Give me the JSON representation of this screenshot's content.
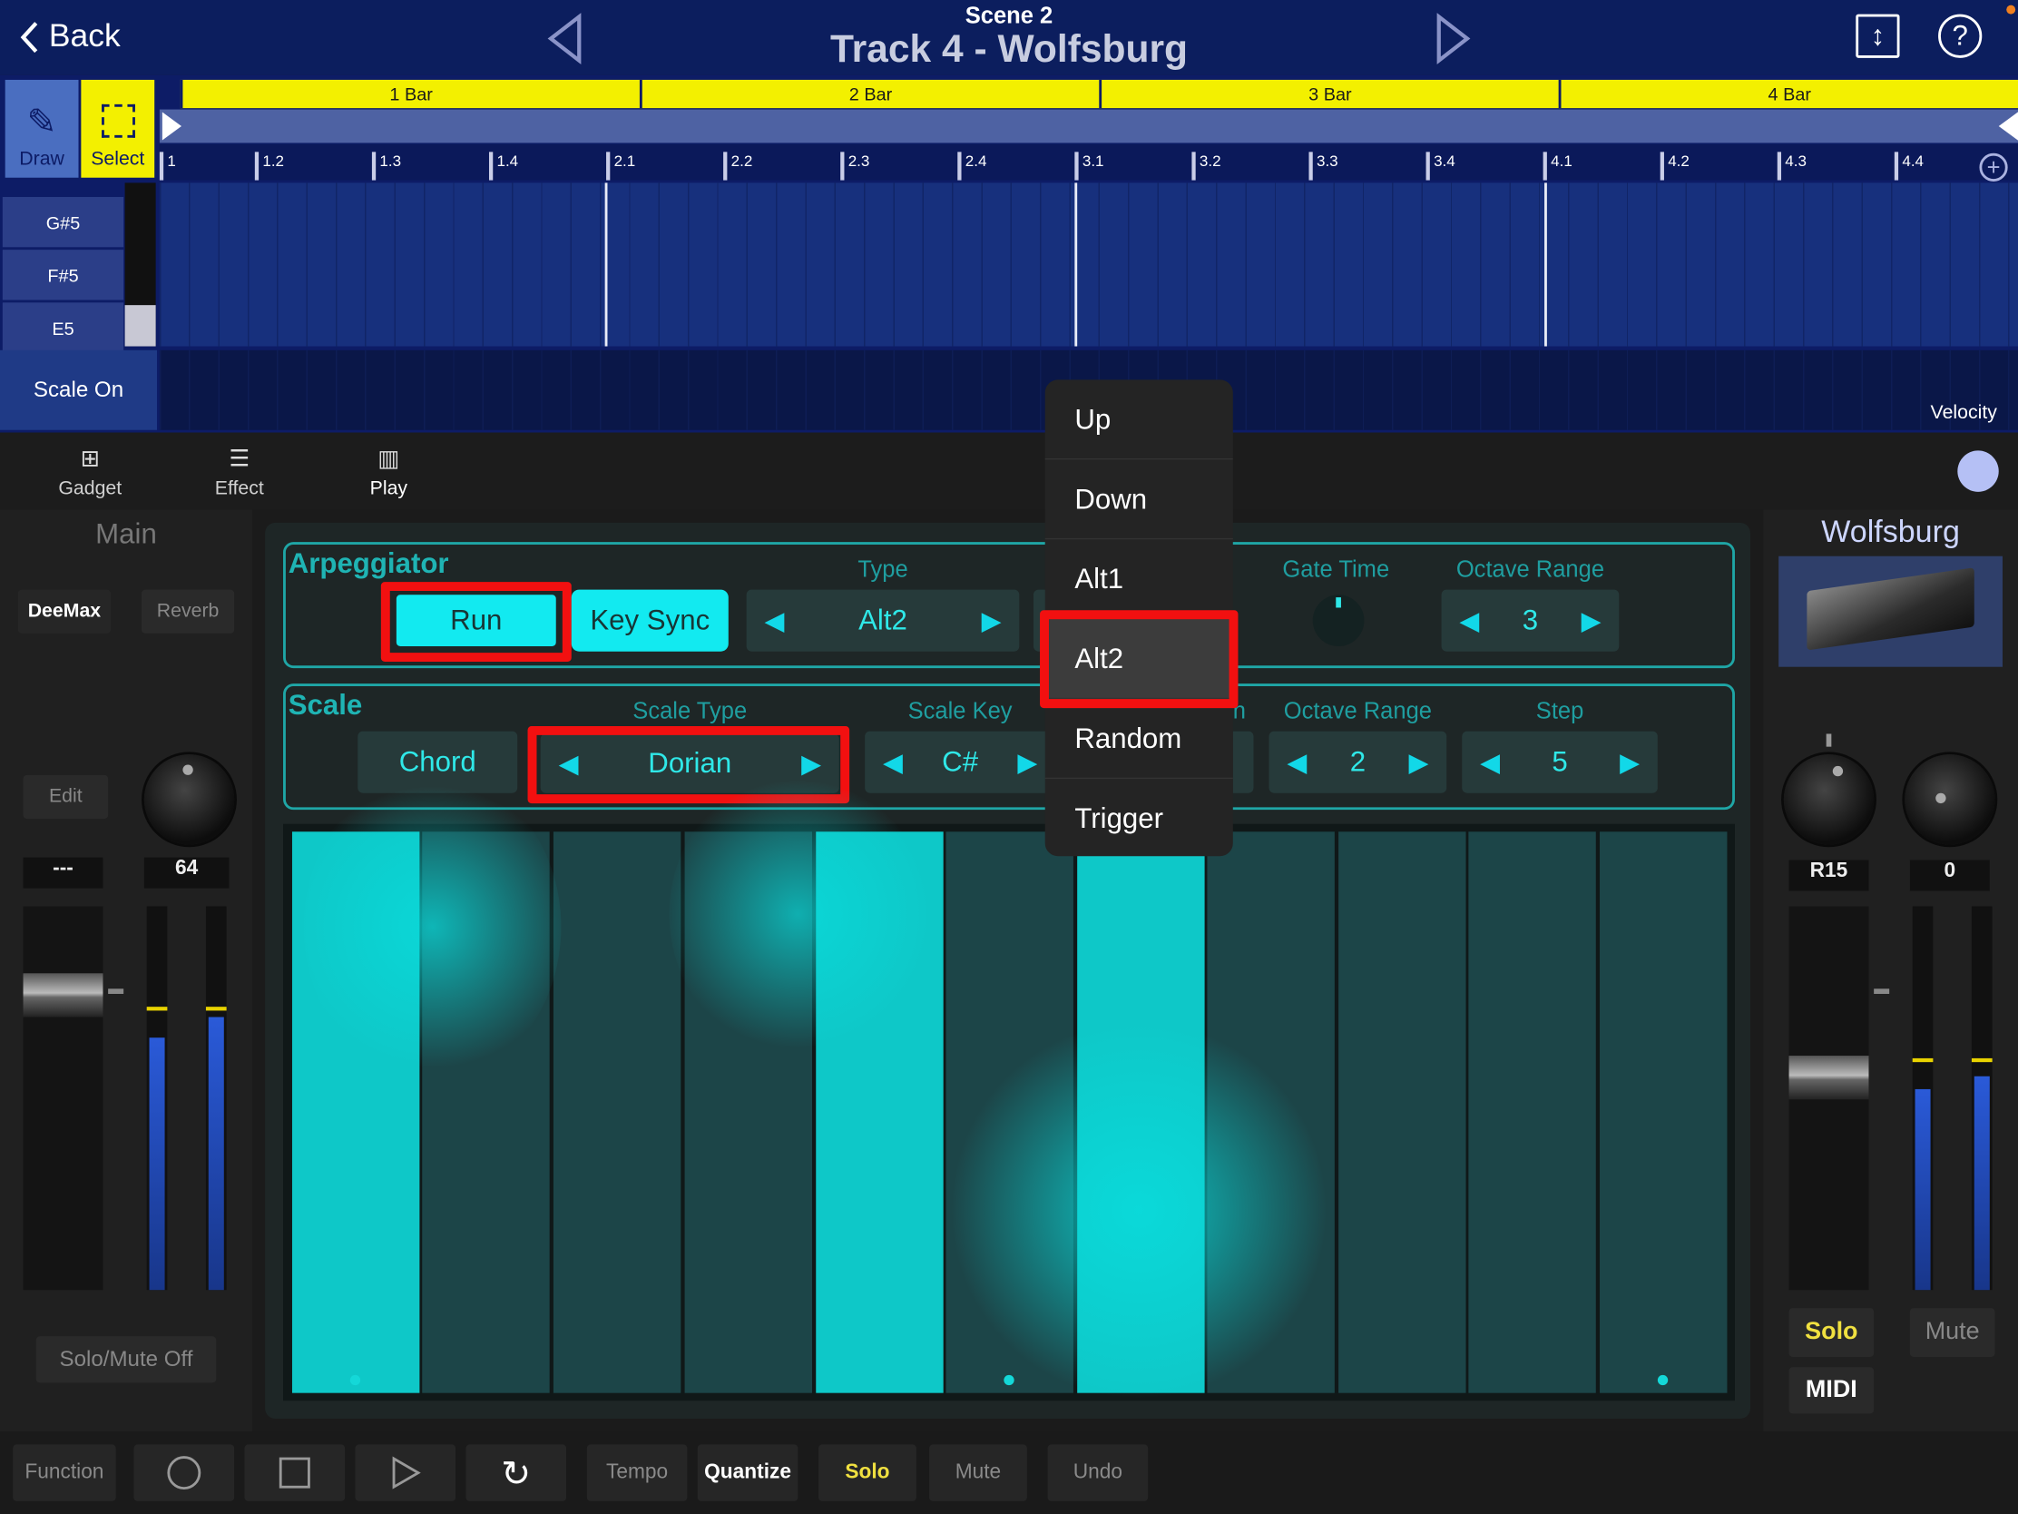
{
  "header": {
    "back": "Back",
    "scene": "Scene 2",
    "track": "Track 4 - Wolfsburg",
    "help": "?"
  },
  "tools": {
    "draw": "Draw",
    "select": "Select"
  },
  "bars": [
    "1 Bar",
    "2 Bar",
    "3 Bar",
    "4 Bar"
  ],
  "ruler": [
    "1",
    "1.2",
    "1.3",
    "1.4",
    "2.1",
    "2.2",
    "2.3",
    "2.4",
    "3.1",
    "3.2",
    "3.3",
    "3.4",
    "4.1",
    "4.2",
    "4.3",
    "4.4"
  ],
  "keys": [
    "G#5",
    "F#5",
    "E5"
  ],
  "scale_on": "Scale On",
  "velocity": "Velocity",
  "tabs": {
    "gadget": "Gadget",
    "effect": "Effect",
    "play": "Play"
  },
  "left_mixer": {
    "title": "Main",
    "fx1": "DeeMax",
    "fx2": "Reverb",
    "edit": "Edit",
    "pan_value": "---",
    "level_value": "64",
    "solo_mute": "Solo/Mute Off"
  },
  "right_mixer": {
    "title": "Wolfsburg",
    "pan_value": "R15",
    "level_value": "0",
    "solo": "Solo",
    "mute": "Mute",
    "midi": "MIDI"
  },
  "arp": {
    "title": "Arpeggiator",
    "run": "Run",
    "key_sync": "Key Sync",
    "type_label": "Type",
    "type_value": "Alt2",
    "gate_label": "Gate Time",
    "oct_label": "Octave Range",
    "oct_value": "3"
  },
  "scale": {
    "title": "Scale",
    "chord": "Chord",
    "type_label": "Scale Type",
    "type_value": "Dorian",
    "key_label": "Scale Key",
    "key_value": "C#",
    "partial_label": "n",
    "oct_label": "Octave Range",
    "oct_value": "2",
    "step_label": "Step",
    "step_value": "5"
  },
  "dropdown": {
    "items": [
      "Up",
      "Down",
      "Alt1",
      "Alt2",
      "Random",
      "Trigger"
    ],
    "selected": "Alt2"
  },
  "bottom": {
    "function": "Function",
    "tempo": "Tempo",
    "quantize": "Quantize",
    "solo": "Solo",
    "mute": "Mute",
    "undo": "Undo"
  },
  "colors": {
    "header": "#0c1e5e",
    "bar_ruler": "#f3f000",
    "accent_cyan": "#0ec8c8",
    "highlight": "#f21010",
    "solo": "#f0e040"
  }
}
